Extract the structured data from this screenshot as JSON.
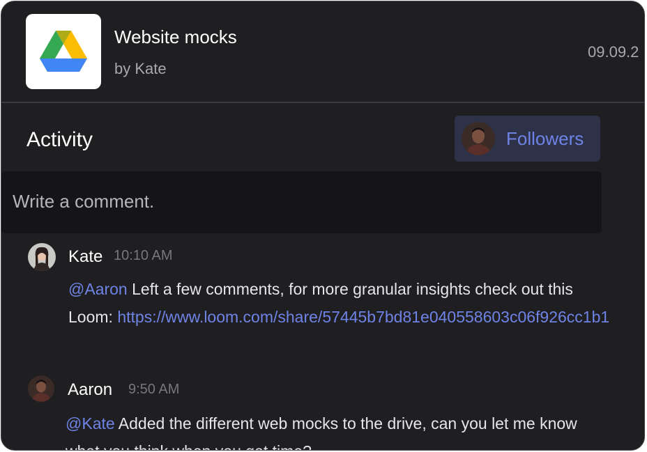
{
  "file": {
    "title": "Website mocks",
    "author": "by Kate",
    "date": "09.09.2",
    "icon": "google-drive-icon"
  },
  "activity": {
    "title": "Activity",
    "followers_label": "Followers",
    "comment_placeholder": "Write a comment."
  },
  "comments": [
    {
      "author": "Kate",
      "time": "10:10 AM",
      "mention": "@Aaron",
      "text_before_link": " Left a few comments, for more granular insights check out this Loom: ",
      "link": "https://www.loom.com/share/57445b7bd81e040558603c06f926cc1b1"
    },
    {
      "author": "Aaron",
      "time": "9:50 AM",
      "mention": "@Kate",
      "text": " Added the different web mocks to the drive, can you let me know what you think when you got time?"
    }
  ],
  "colors": {
    "background": "#1f1f22",
    "accent": "#6f83e6",
    "followers_button": "#2d3249",
    "comment_box": "#151517"
  }
}
